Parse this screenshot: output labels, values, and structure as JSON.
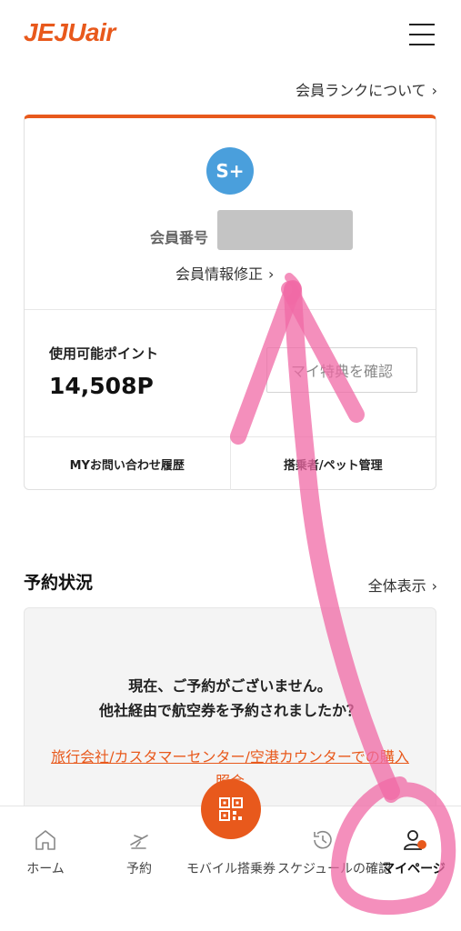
{
  "header": {
    "logo_text": "JEJUair",
    "menu_icon": "hamburger-menu-icon",
    "brand_color": "#e8591c"
  },
  "rank_link": {
    "label": "会員ランクについて",
    "chevron": "›"
  },
  "member_card": {
    "avatar_text": "S+",
    "avatar_color": "#4a9fdc",
    "member_number_label": "会員番号",
    "edit_label": "会員情報修正",
    "points_label": "使用可能ポイント",
    "points_value": "14,508P",
    "benefit_button": "マイ特典を確認",
    "inquiry_history": "MYお問い合わせ履歴",
    "passenger_pet": "搭乗者/ペット管理"
  },
  "reservation": {
    "title": "予約状況",
    "view_all": "全体表示",
    "message_line1": "現在、ご予約がございません。",
    "message_line2": "他社経由で航空券を予約されましたか？",
    "link_line1": "旅行会社/カスタマーセンター/空港カウンターでの購入",
    "link_line2": "照会"
  },
  "bottom_nav": {
    "home": "ホーム",
    "booking": "予約",
    "mobile_boarding": "モバイル搭乗券",
    "schedule": "スケジュールの確認",
    "mypage": "マイページ"
  },
  "annotation_color": "#f06aa6"
}
